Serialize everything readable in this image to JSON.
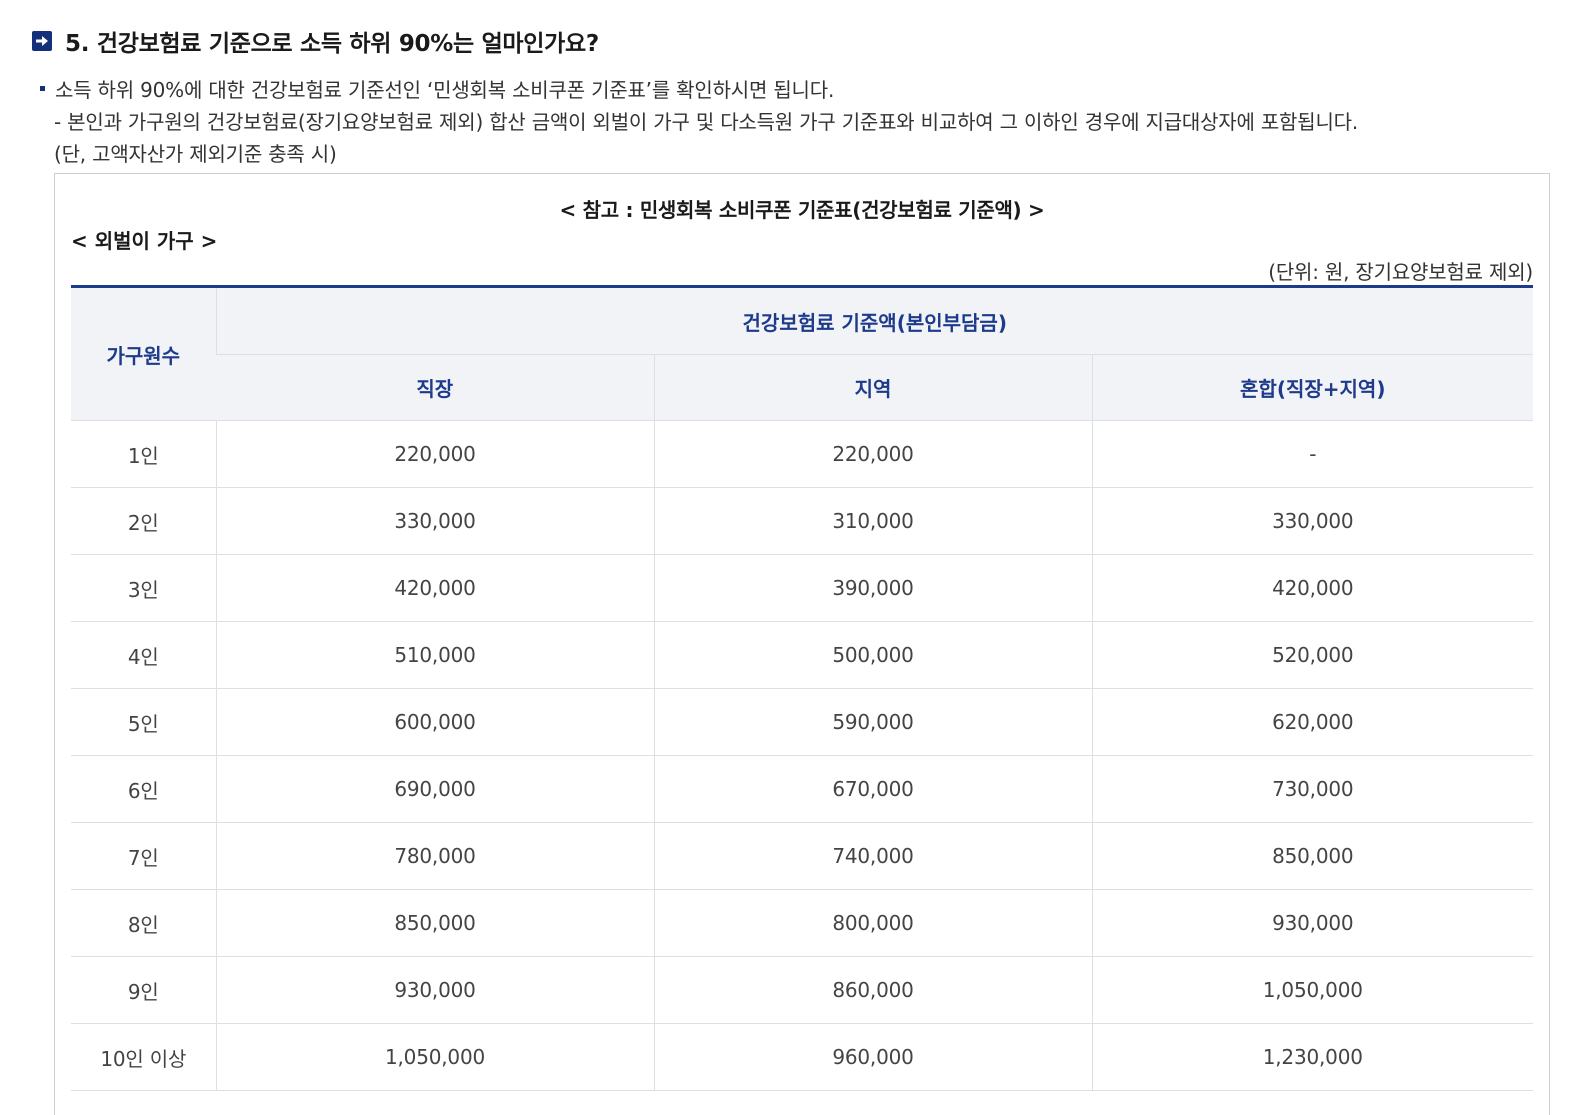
{
  "question": {
    "icon": "arrow-right-icon",
    "title": "5. 건강보험료 기준으로 소득 하위 90%는 얼마인가요?"
  },
  "description": {
    "line1": "소득 하위 90%에 대한 건강보험료 기준선인 ‘민생회복 소비쿠폰 기준표’를 확인하시면 됩니다.",
    "line2": "- 본인과 가구원의 건강보험료(장기요양보험료 제외) 합산 금액이 외벌이 가구 및 다소득원 가구 기준표와 비교하여 그 이하인 경우에 지급대상자에 포함됩니다.",
    "line3": "(단, 고액자산가 제외기준 충족 시)"
  },
  "reference": {
    "title": "< 참고 : 민생회복 소비쿠폰 기준표(건강보험료 기준액) >",
    "subtitle": "< 외벌이 가구 >",
    "unit": "(단위: 원, 장기요양보험료 제외)"
  },
  "table": {
    "head_household": "가구원수",
    "head_group": "건강보험료 기준액(본인부담금)",
    "head_work": "직장",
    "head_region": "지역",
    "head_mixed": "혼합(직장+지역)",
    "rows": [
      {
        "size": "1인",
        "work": "220,000",
        "region": "220,000",
        "mixed": "-"
      },
      {
        "size": "2인",
        "work": "330,000",
        "region": "310,000",
        "mixed": "330,000"
      },
      {
        "size": "3인",
        "work": "420,000",
        "region": "390,000",
        "mixed": "420,000"
      },
      {
        "size": "4인",
        "work": "510,000",
        "region": "500,000",
        "mixed": "520,000"
      },
      {
        "size": "5인",
        "work": "600,000",
        "region": "590,000",
        "mixed": "620,000"
      },
      {
        "size": "6인",
        "work": "690,000",
        "region": "670,000",
        "mixed": "730,000"
      },
      {
        "size": "7인",
        "work": "780,000",
        "region": "740,000",
        "mixed": "850,000"
      },
      {
        "size": "8인",
        "work": "850,000",
        "region": "800,000",
        "mixed": "930,000"
      },
      {
        "size": "9인",
        "work": "930,000",
        "region": "860,000",
        "mixed": "1,050,000"
      },
      {
        "size": "10인 이상",
        "work": "1,050,000",
        "region": "960,000",
        "mixed": "1,230,000"
      }
    ]
  },
  "colors": {
    "accent": "#1e3a8a",
    "icon_bg": "#14307a",
    "header_bg": "#f1f3f6"
  }
}
